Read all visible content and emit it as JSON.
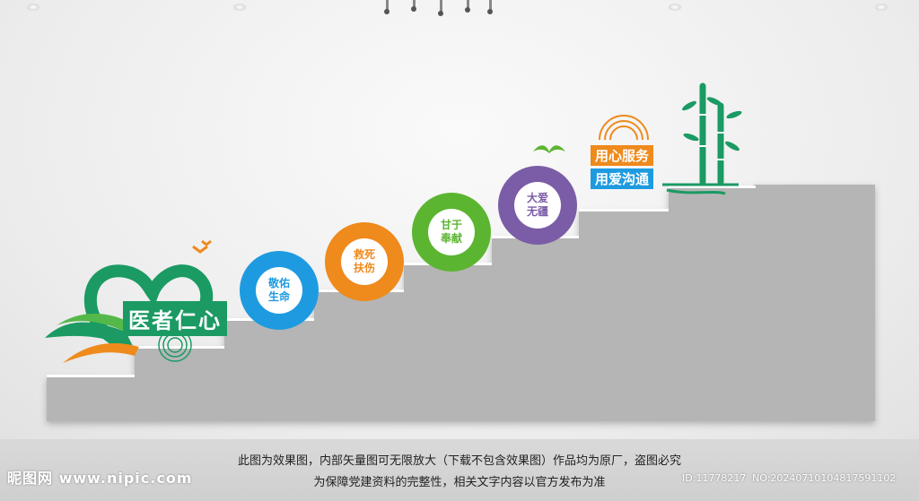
{
  "main_sign": {
    "title": "医者仁心"
  },
  "badges": [
    {
      "text": "敬佑\n生命",
      "color": "#1e9be0"
    },
    {
      "text": "救死\n扶伤",
      "color": "#ef8a1c"
    },
    {
      "text": "甘于\n奉献",
      "color": "#5cb531"
    },
    {
      "text": "大爱\n无疆",
      "color": "#7b5ca6"
    }
  ],
  "service_tag": {
    "line1": "用心服务",
    "line2": "用爱沟通",
    "line1_color": "#ef8a1c",
    "line2_color": "#1e9be0"
  },
  "colors": {
    "green": "#1b9a63",
    "stair": "#b3b3b3",
    "stair_top": "#ffffff"
  },
  "caption": {
    "line1": "此图为效果图，内部矢量图可无限放大（下载不包含效果图）作品均为原厂，盗图必究",
    "line2": "为保障党建资料的完整性，相关文字内容以官方发布为准"
  },
  "watermark": {
    "site": "昵图网 www.nipic.com",
    "id": "ID:11778217",
    "no": "NO:20240710104817591102"
  }
}
